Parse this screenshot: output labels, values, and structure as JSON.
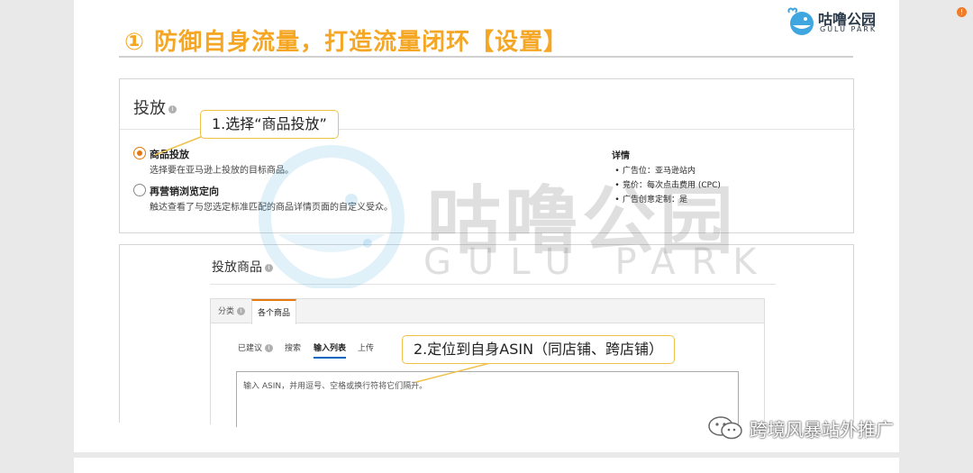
{
  "slide": {
    "title": "① 防御自身流量，打造流量闭环【设置】",
    "logo_cn": "咕噜公园",
    "logo_en": "GULU PARK"
  },
  "targeting": {
    "heading": "投放",
    "options": [
      {
        "title": "商品投放",
        "description": "选择要在亚马逊上投放的目标商品。",
        "selected": true
      },
      {
        "title": "再营销浏览定向",
        "description": "触达查看了与您选定标准匹配的商品详情页面的自定义受众。",
        "selected": false
      }
    ],
    "details": {
      "title": "详情",
      "items": [
        "广告位：亚马逊站内",
        "竞价：每次点击费用 (CPC)",
        "广告创意定制：是"
      ]
    }
  },
  "products": {
    "heading": "投放商品",
    "tabs": [
      "分类",
      "各个商品"
    ],
    "subtabs": [
      "已建议",
      "搜索",
      "输入列表",
      "上传"
    ],
    "input_placeholder": "输入 ASIN，并用逗号、空格或换行符将它们隔开。"
  },
  "callouts": {
    "step1": "1.选择“商品投放”",
    "step2": "2.定位到自身ASIN（同店铺、跨店铺）"
  },
  "watermark": {
    "cn": "咕噜公园",
    "en": "GULU PARK"
  },
  "footer": {
    "wechat_account": "跨境风暴站外推广"
  },
  "colors": {
    "title": "#f5a623",
    "callout_border": "#f0c24a",
    "accent": "#e47911",
    "watermark": "#6e6e6e"
  }
}
